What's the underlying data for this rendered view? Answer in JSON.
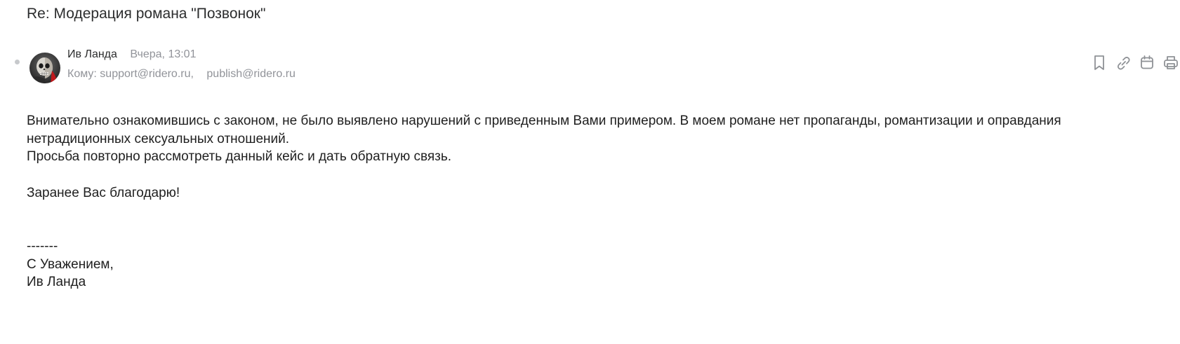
{
  "message": {
    "subject": "Re: Модерация романа \"Позвонок\"",
    "sender": {
      "name": "Ив Ланда",
      "date": "Вчера, 13:01"
    },
    "recipients_label": "Кому:",
    "recipients": [
      "support@ridero.ru,",
      "publish@ridero.ru"
    ],
    "toolbar": [
      {
        "icon": "bookmark-icon"
      },
      {
        "icon": "link-icon"
      },
      {
        "icon": "calendar-icon"
      },
      {
        "icon": "print-icon"
      }
    ],
    "body": {
      "paragraph1": "Внимательно ознакомившись с законом, не было выявлено нарушений с приведенным Вами примером. В моем романе нет пропаганды, романтизации и оправдания нетрадиционных сексуальных отношений.",
      "paragraph2": "Просьба повторно рассмотреть данный кейс и дать обратную связь.",
      "thanks": "Заранее Вас благодарю!",
      "separator": "-------",
      "closing": "С Уважением,",
      "signature": "Ив Ланда"
    }
  }
}
